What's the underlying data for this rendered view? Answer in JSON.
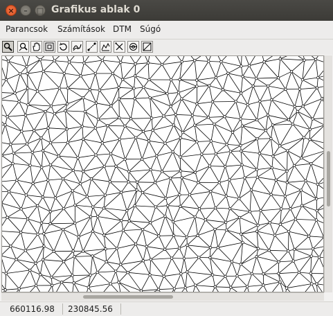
{
  "window": {
    "title": "Grafikus ablak 0",
    "close_glyph": "×",
    "minimize_glyph": "–",
    "maximize_glyph": "□"
  },
  "menubar": {
    "items": [
      "Parancsok",
      "Számítások",
      "DTM",
      "Súgó"
    ]
  },
  "toolbar": {
    "tools": [
      {
        "icon": "zoom-window-icon",
        "active": true
      },
      {
        "icon": "zoom-icon",
        "active": false
      },
      {
        "icon": "pan-hand-icon",
        "active": false
      },
      {
        "icon": "zoom-extents-icon",
        "active": false
      },
      {
        "icon": "refresh-icon",
        "active": false
      },
      {
        "icon": "contour-icon",
        "active": false
      },
      {
        "icon": "edge-icon",
        "active": false
      },
      {
        "icon": "profile-icon",
        "active": false
      },
      {
        "icon": "delete-edge-icon",
        "active": false
      },
      {
        "icon": "settings-icon",
        "active": false
      },
      {
        "icon": "clear-icon",
        "active": false
      }
    ]
  },
  "canvas": {
    "content": "tin-triangle-mesh",
    "stroke_color": "#000000",
    "background_color": "#ffffff"
  },
  "statusbar": {
    "x_coord": "660116.98",
    "y_coord": "230845.56"
  },
  "colors": {
    "titlebar": "#3c3b37",
    "close_button": "#e2571e",
    "chrome": "#edeceb"
  }
}
